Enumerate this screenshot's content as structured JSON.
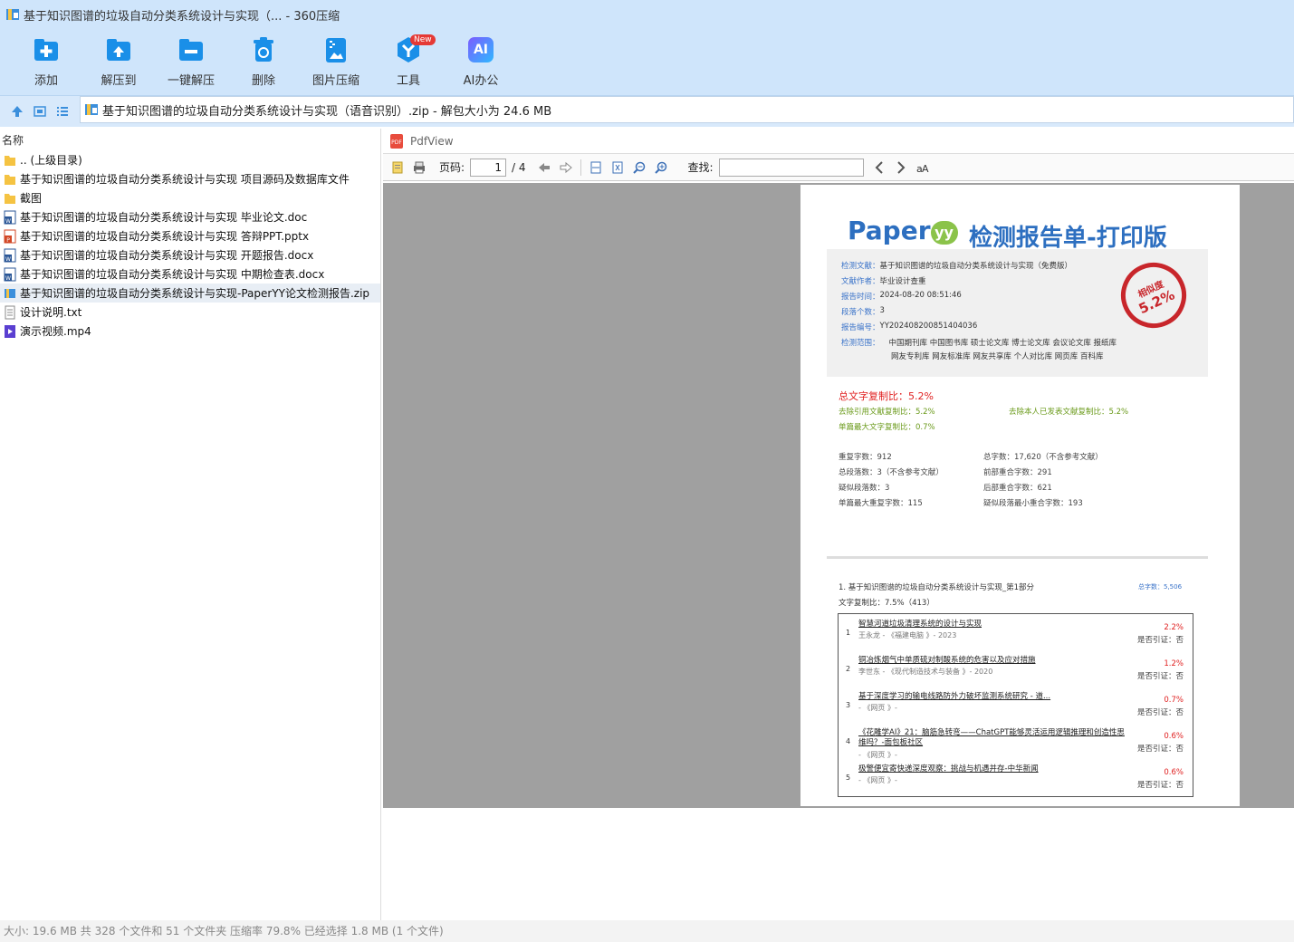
{
  "window": {
    "title": "基于知识图谱的垃圾自动分类系统设计与实现（... - 360压缩"
  },
  "toolbar": {
    "add": "添加",
    "extract_to": "解压到",
    "one_click": "一键解压",
    "delete": "删除",
    "image_compress": "图片压缩",
    "tools": "工具",
    "tools_badge": "New",
    "ai_office": "AI办公",
    "ai_icon_text": "AI"
  },
  "path": "基于知识图谱的垃圾自动分类系统设计与实现（语音识别）.zip - 解包大小为 24.6 MB",
  "file_list": {
    "header": "名称",
    "items": [
      {
        "name": ".. (上级目录)",
        "type": "folder"
      },
      {
        "name": "基于知识图谱的垃圾自动分类系统设计与实现 项目源码及数据库文件",
        "type": "folder"
      },
      {
        "name": "截图",
        "type": "folder"
      },
      {
        "name": "基于知识图谱的垃圾自动分类系统设计与实现 毕业论文.doc",
        "type": "word"
      },
      {
        "name": "基于知识图谱的垃圾自动分类系统设计与实现 答辩PPT.pptx",
        "type": "ppt"
      },
      {
        "name": "基于知识图谱的垃圾自动分类系统设计与实现 开题报告.docx",
        "type": "word"
      },
      {
        "name": "基于知识图谱的垃圾自动分类系统设计与实现 中期检查表.docx",
        "type": "word"
      },
      {
        "name": "基于知识图谱的垃圾自动分类系统设计与实现-PaperYY论文检测报告.zip",
        "type": "zip"
      },
      {
        "name": "设计说明.txt",
        "type": "txt"
      },
      {
        "name": "演示视频.mp4",
        "type": "video"
      }
    ]
  },
  "pdfview": {
    "title": "PdfView",
    "page_label": "页码:",
    "page_current": "1",
    "page_total": "/ 4",
    "find_label": "查找:",
    "find_value": ""
  },
  "report": {
    "logo": "Paper",
    "logo_mark": "yy",
    "logo_title": "检测报告单-打印版",
    "info": [
      {
        "k": "检测文献：",
        "v": "基于知识图谱的垃圾自动分类系统设计与实现（免费版）"
      },
      {
        "k": "文献作者：",
        "v": "毕业设计查重"
      },
      {
        "k": "报告时间：",
        "v": "2024-08-20 08:51:46"
      },
      {
        "k": "段落个数：",
        "v": "3"
      },
      {
        "k": "报告编号：",
        "v": "YY202408200851404036"
      },
      {
        "k": "检测范围：",
        "v": "中国期刊库 中国图书库 硕士论文库 博士论文库 会议论文库 报纸库"
      }
    ],
    "range_line2": "网友专利库 网友标准库 网友共享库 个人对比库 网页库 百科库",
    "stamp_label": "相似度",
    "stamp_value": "5.2%",
    "total_ratio": "总文字复制比：5.2%",
    "exclude_ref": "去除引用文献复制比：5.2%",
    "exclude_self": "去除本人已发表文献复制比：5.2%",
    "single_max": "单篇最大文字复制比：0.7%",
    "stats_left": [
      "重复字数：912",
      "总段落数：3（不含参考文献）",
      "疑似段落数：3",
      "单篇最大重复字数：115"
    ],
    "stats_right": [
      "总字数：17,620（不含参考文献）",
      "前部重合字数：291",
      "后部重合字数：621",
      "疑似段落最小重合字数：193"
    ],
    "section_title": "1. 基于知识图谱的垃圾自动分类系统设计与实现_第1部分",
    "section_words": "总字数：5,506",
    "section_ratio": "文字复制比：7.5%（413）",
    "cited_label": "是否引证：否",
    "rows": [
      {
        "n": "1",
        "t": "智慧河道垃圾清理系统的设计与实现",
        "s": "王永龙 - 《福建电脑 》- 2023",
        "p": "2.2%"
      },
      {
        "n": "2",
        "t": "铜冶炼烟气中单质硫对制酸系统的危害以及应对措施",
        "s": "李世东 - 《现代制造技术与装备 》- 2020",
        "p": "1.2%"
      },
      {
        "n": "3",
        "t": "基于深度学习的输电线路防外力破坏监测系统研究 - 道...",
        "s": "- 《网页 》-",
        "p": "0.7%"
      },
      {
        "n": "4",
        "t": "《花雕学AI》21：脑筋急转弯——ChatGPT能够灵活运用逻辑推理和创造性思维吗？-面包板社区",
        "s": "- 《网页 》-",
        "p": "0.6%"
      },
      {
        "n": "5",
        "t": "极警便宜寄快递深度观察：挑战与机遇并存-中华新闻",
        "s": "- 《网页 》-",
        "p": "0.6%"
      }
    ]
  },
  "status": "大小: 19.6 MB 共 328 个文件和 51 个文件夹 压缩率 79.8% 已经选择 1.8 MB (1 个文件)",
  "colors": {
    "toolbar_bg": "#cfe5fb",
    "icon_blue": "#1a8fe8",
    "accent_red": "#e02020"
  }
}
